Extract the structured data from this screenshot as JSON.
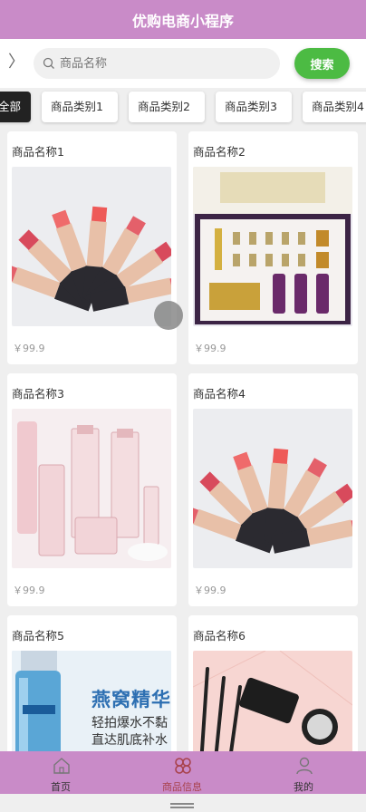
{
  "app": {
    "title": "优购电商小程序"
  },
  "search": {
    "placeholder": "商品名称",
    "button_label": "搜索"
  },
  "categories": [
    {
      "label": "全部",
      "active": true
    },
    {
      "label": "商品类别1",
      "active": false
    },
    {
      "label": "商品类别2",
      "active": false
    },
    {
      "label": "商品类别3",
      "active": false
    },
    {
      "label": "商品类别4",
      "active": false
    }
  ],
  "products": [
    {
      "name": "商品名称1",
      "price": "￥99.9",
      "image": "lipsticks"
    },
    {
      "name": "商品名称2",
      "price": "￥99.9",
      "image": "skincare-gift-box"
    },
    {
      "name": "商品名称3",
      "price": "￥99.9",
      "image": "pink-cosmetic-bottles"
    },
    {
      "name": "商品名称4",
      "price": "￥99.9",
      "image": "lipsticks"
    },
    {
      "name": "商品名称5",
      "price": "",
      "image": "blue-serum-ad",
      "image_text": [
        "燕窝精华",
        "轻拍爆水不黏",
        "直达肌底补水"
      ]
    },
    {
      "name": "商品名称6",
      "price": "",
      "image": "makeup-flatlay"
    }
  ],
  "tabbar": [
    {
      "label": "首页",
      "icon": "home-icon",
      "active": false
    },
    {
      "label": "商品信息",
      "icon": "clover-icon",
      "active": true
    },
    {
      "label": "我的",
      "icon": "user-icon",
      "active": false
    }
  ],
  "colors": {
    "header": "#c98bc8",
    "search_button": "#4cbb43",
    "active_tab_label": "#a8424c",
    "active_category_bg": "#222222"
  }
}
